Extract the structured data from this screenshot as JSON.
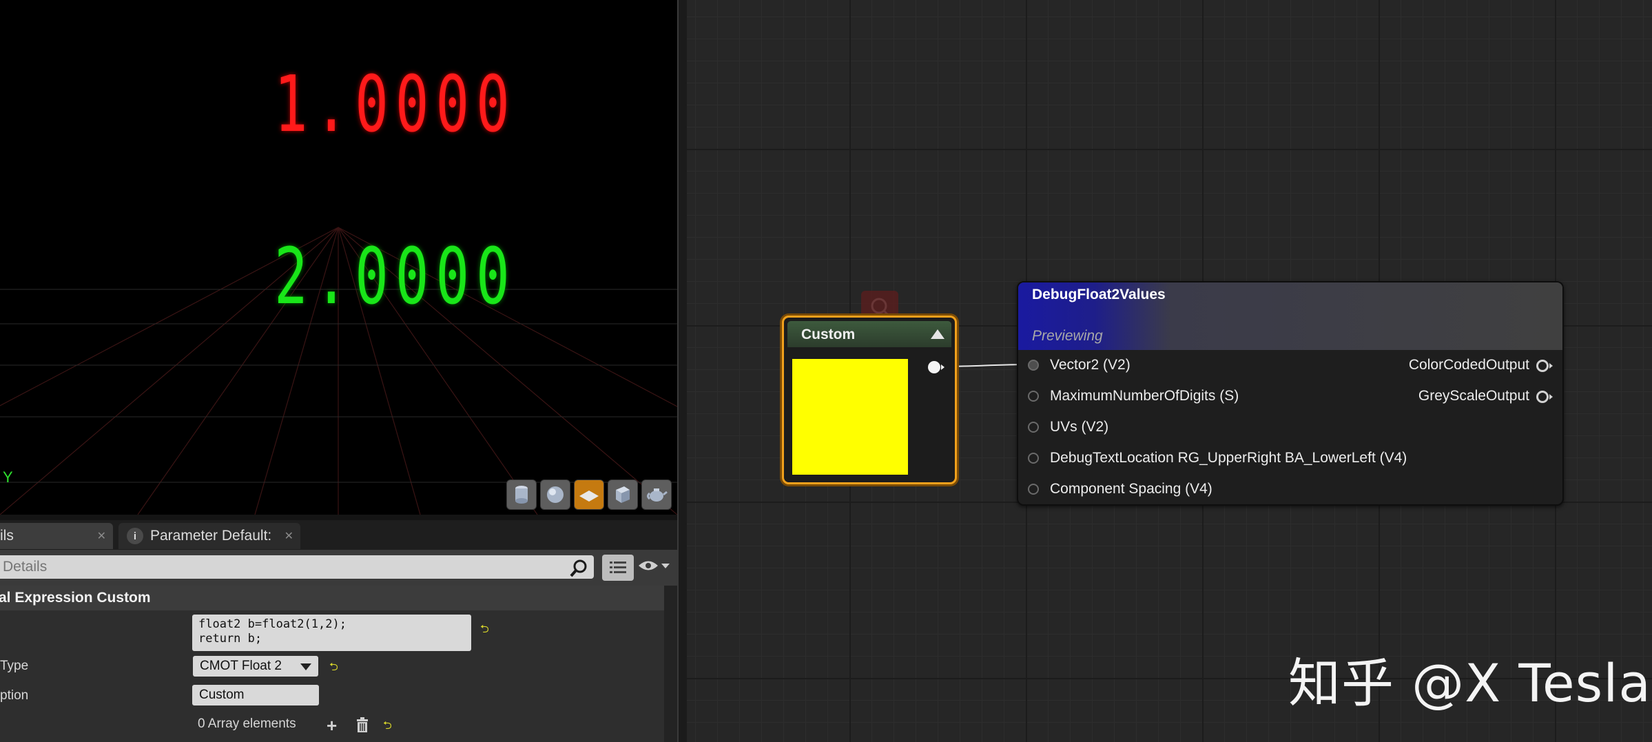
{
  "viewport": {
    "value_row_1": "1.0000",
    "value_row_2": "2.0000",
    "axis_label": "Y",
    "toolbar_icons": [
      "cylinder-icon",
      "sphere-icon",
      "plane-icon",
      "cube-icon",
      "teapot-icon"
    ]
  },
  "details": {
    "tab_details": "ils",
    "tab_params": "Parameter Default:",
    "search_placeholder": "Details",
    "category_title": "al Expression Custom",
    "code": "float2 b=float2(1,2);\nreturn b;",
    "output_type_label": "Type",
    "output_type_value": "CMOT Float 2",
    "description_label": "ption",
    "description_value": "Custom",
    "inputs_value": "0 Array elements"
  },
  "graph": {
    "custom_node_title": "Custom",
    "preview_color": "#ffff00",
    "debug_node_title": "DebugFloat2Values",
    "debug_node_subtitle": "Previewing",
    "inputs": [
      "Vector2 (V2)",
      "MaximumNumberOfDigits (S)",
      "UVs (V2)",
      "DebugTextLocation RG_UpperRight BA_LowerLeft (V4)",
      "Component Spacing (V4)"
    ],
    "outputs": [
      "ColorCodedOutput",
      "GreyScaleOutput"
    ]
  },
  "watermark": "知乎 @X Tesla"
}
